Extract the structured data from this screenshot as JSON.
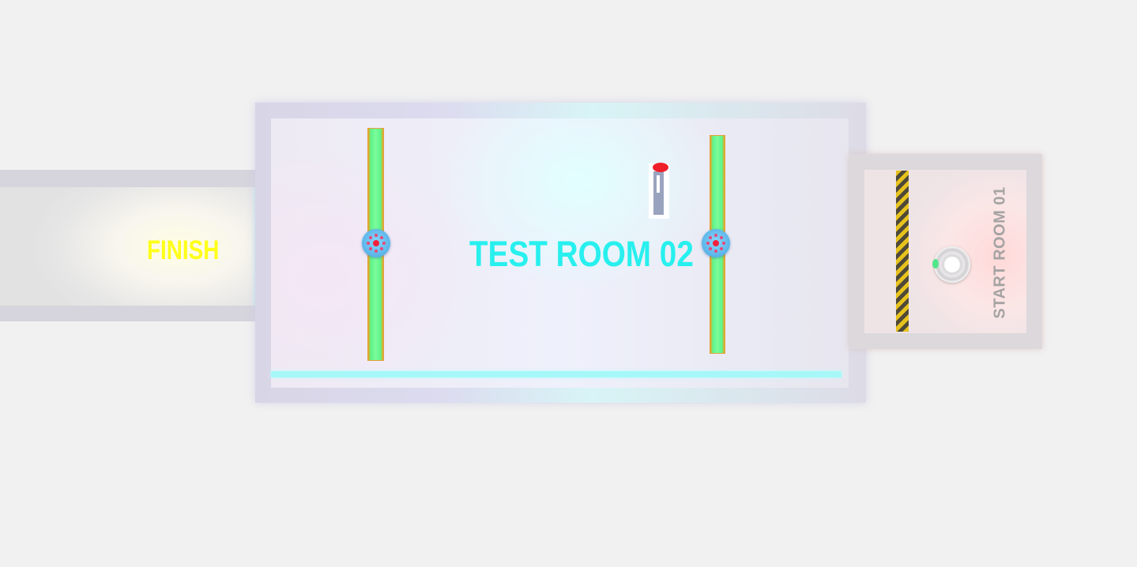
{
  "level": {
    "finish_label": "FINISH",
    "room_title": "TEST ROOM 02",
    "start_label": "START ROOM 01"
  },
  "colors": {
    "finish_text": "#ffff1a",
    "room_title_text": "#27f0ee",
    "start_text": "#a5a3a3",
    "rail": "#7dfb9a",
    "rail_border": "#f0a21c",
    "disc": "#5cb6ea",
    "lever_knob": "#ef1f2a",
    "hazard_yellow": "#e7c21d",
    "gate_glow": "#9ff6f4"
  },
  "objects": [
    {
      "name": "finish-gate",
      "kind": "glowing barrier"
    },
    {
      "name": "rail-left",
      "kind": "sliding rail with disc"
    },
    {
      "name": "rail-right",
      "kind": "sliding rail with disc"
    },
    {
      "name": "lever",
      "kind": "switch with red knob"
    },
    {
      "name": "hazard-stripe",
      "kind": "caution floor stripe"
    },
    {
      "name": "spawn-ring",
      "kind": "player spawn point"
    }
  ]
}
